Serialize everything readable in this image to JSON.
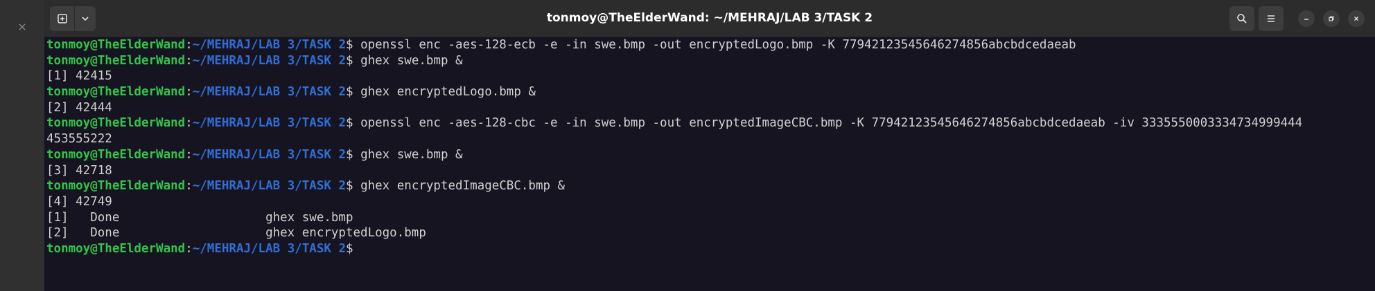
{
  "window": {
    "title": "tonmoy@TheElderWand: ~/MEHRAJ/LAB 3/TASK 2"
  },
  "icons": {
    "left_close": "close-icon",
    "new_tab": "new-tab-icon",
    "tab_menu": "chevron-down-icon",
    "search": "search-icon",
    "menu": "hamburger-menu-icon",
    "minimize": "minimize-icon",
    "maximize": "restore-icon",
    "close": "close-icon"
  },
  "left_strip": {
    "close_glyph": "×"
  },
  "colors": {
    "background": "#171421",
    "user_host": "#33c44a",
    "path": "#2f6fd6",
    "text": "#d0d0d0",
    "titlebar": "#2c2c2c"
  },
  "prompt": {
    "user_host": "tonmoy@TheElderWand",
    "colon": ":",
    "path": "~/MEHRAJ/LAB 3/TASK 2",
    "symbol": "$ "
  },
  "lines": [
    {
      "type": "prompt",
      "command": "openssl enc -aes-128-ecb -e -in swe.bmp -out encryptedLogo.bmp -K 77942123545646274856abcbdcedaeab"
    },
    {
      "type": "prompt",
      "command": "ghex swe.bmp &"
    },
    {
      "type": "output",
      "text": "[1] 42415"
    },
    {
      "type": "prompt",
      "command": "ghex encryptedLogo.bmp &"
    },
    {
      "type": "output",
      "text": "[2] 42444"
    },
    {
      "type": "prompt",
      "command": "openssl enc -aes-128-cbc -e -in swe.bmp -out encryptedImageCBC.bmp -K 77942123545646274856abcbdcedaeab -iv 3335550003334734999444"
    },
    {
      "type": "output",
      "text": "453555222"
    },
    {
      "type": "prompt",
      "command": "ghex swe.bmp &"
    },
    {
      "type": "output",
      "text": "[3] 42718"
    },
    {
      "type": "prompt",
      "command": "ghex encryptedImageCBC.bmp &"
    },
    {
      "type": "output",
      "text": "[4] 42749"
    },
    {
      "type": "output",
      "text": "[1]   Done                    ghex swe.bmp"
    },
    {
      "type": "output",
      "text": "[2]   Done                    ghex encryptedLogo.bmp"
    },
    {
      "type": "prompt",
      "command": ""
    }
  ]
}
